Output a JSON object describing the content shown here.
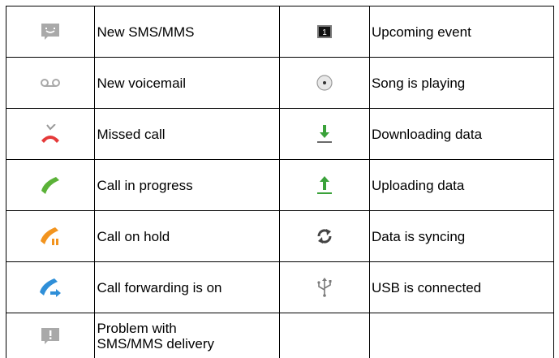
{
  "rows": [
    {
      "left": {
        "icon": "sms-mms-icon",
        "label": "New SMS/MMS"
      },
      "right": {
        "icon": "calendar-event-icon",
        "label": "Upcoming event",
        "badge": "1"
      }
    },
    {
      "left": {
        "icon": "voicemail-icon",
        "label": "New voicemail"
      },
      "right": {
        "icon": "music-playing-icon",
        "label": "Song is playing"
      }
    },
    {
      "left": {
        "icon": "missed-call-icon",
        "label": "Missed call"
      },
      "right": {
        "icon": "download-icon",
        "label": "Downloading data"
      }
    },
    {
      "left": {
        "icon": "call-in-progress-icon",
        "label": "Call in progress"
      },
      "right": {
        "icon": "upload-icon",
        "label": "Uploading data"
      }
    },
    {
      "left": {
        "icon": "call-on-hold-icon",
        "label": "Call on hold"
      },
      "right": {
        "icon": "sync-icon",
        "label": "Data is syncing"
      }
    },
    {
      "left": {
        "icon": "call-forwarding-icon",
        "label": "Call forwarding is on"
      },
      "right": {
        "icon": "usb-icon",
        "label": "USB is connected"
      }
    },
    {
      "left": {
        "icon": "sms-delivery-problem-icon",
        "label_line1": "Problem with",
        "label_line2": "SMS/MMS delivery"
      },
      "right": {
        "label": ""
      }
    }
  ],
  "colors": {
    "border": "#000000",
    "gray_icon": "#a9a9a9",
    "missed_red": "#e53a3a",
    "call_green": "#5bb238",
    "hold_orange": "#f2941f",
    "forward_blue": "#2f8fd8",
    "download_green": "#3aa23a"
  }
}
